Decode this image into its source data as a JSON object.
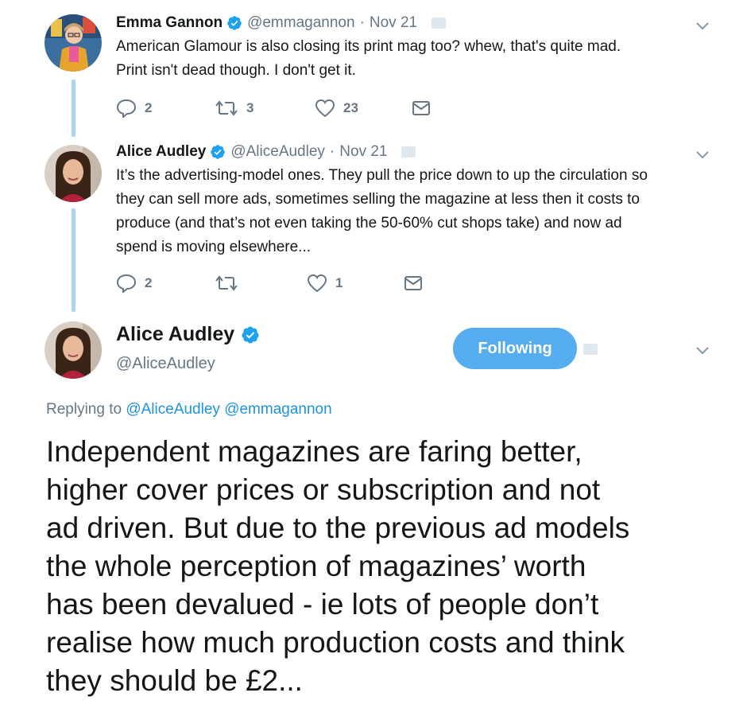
{
  "tweets": [
    {
      "name": "Emma Gannon",
      "handle": "@emmagannon",
      "separator": "·",
      "time": "Nov 21",
      "text_lines": [
        "American Glamour is also closing its print mag too? whew, that's quite mad.",
        "Print isn't dead though. I don't get it."
      ],
      "replies": "2",
      "retweets": "3",
      "likes": "23"
    },
    {
      "name": "Alice Audley",
      "handle": "@AliceAudley",
      "separator": "·",
      "time": "Nov 21",
      "text_lines": [
        "It’s the advertising-model ones. They pull the price down to up the circulation so",
        "they can sell more ads, sometimes selling the magazine at less then it costs to",
        "produce (and that’s not even taking the 50-60% cut shops take) and now ad",
        "spend is moving elsewhere..."
      ],
      "replies": "2",
      "retweets": "",
      "likes": "1"
    }
  ],
  "main_tweet": {
    "name": "Alice Audley",
    "handle": "@AliceAudley",
    "follow_label": "Following",
    "replying_prefix": "Replying to",
    "replying_to": [
      "@AliceAudley",
      "@emmagannon"
    ],
    "text_lines": [
      "Independent magazines are faring better,",
      "higher cover prices or subscription and not",
      "ad driven. But due to the previous ad models",
      "the whole perception of magazines’ worth",
      "has been devalued - ie lots of people don’t",
      "realise how much production costs and think",
      "they should be £2..."
    ]
  },
  "colors": {
    "accent": "#1DA1F2",
    "follow_button": "#55acee",
    "muted_text": "#657786",
    "thread_line": "#a8d4f5",
    "link": "#1b95e0"
  },
  "icons": [
    "verified-badge-icon",
    "reply-icon",
    "retweet-icon",
    "like-icon",
    "direct-message-icon",
    "chevron-down-icon"
  ]
}
